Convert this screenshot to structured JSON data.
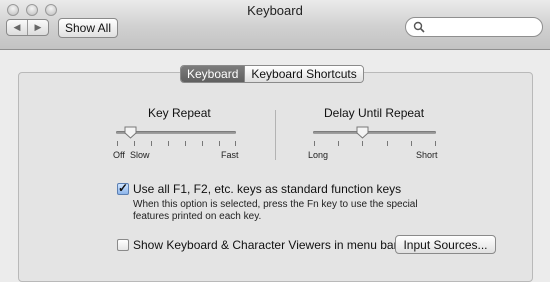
{
  "window": {
    "title": "Keyboard",
    "nav_back": "◀",
    "nav_forward": "▶",
    "show_all": "Show All",
    "search_placeholder": ""
  },
  "tabs": [
    {
      "label": "Keyboard",
      "active": true
    },
    {
      "label": "Keyboard Shortcuts",
      "active": false
    }
  ],
  "key_repeat": {
    "label": "Key Repeat",
    "min_label": "Off",
    "min2_label": "Slow",
    "max_label": "Fast",
    "level": 0.12
  },
  "delay_until_repeat": {
    "label": "Delay Until Repeat",
    "min_label": "Long",
    "max_label": "Short",
    "level": 0.4
  },
  "options": {
    "function_keys_label": "Use all F1, F2, etc. keys as standard function keys",
    "function_keys_checked": true,
    "function_keys_desc_line1": "When this option is selected, press the Fn key to use the special",
    "function_keys_desc_line2": "features printed on each key.",
    "viewers_label": "Show Keyboard & Character Viewers in menu bar",
    "viewers_checked": false,
    "input_sources_button": "Input Sources..."
  }
}
